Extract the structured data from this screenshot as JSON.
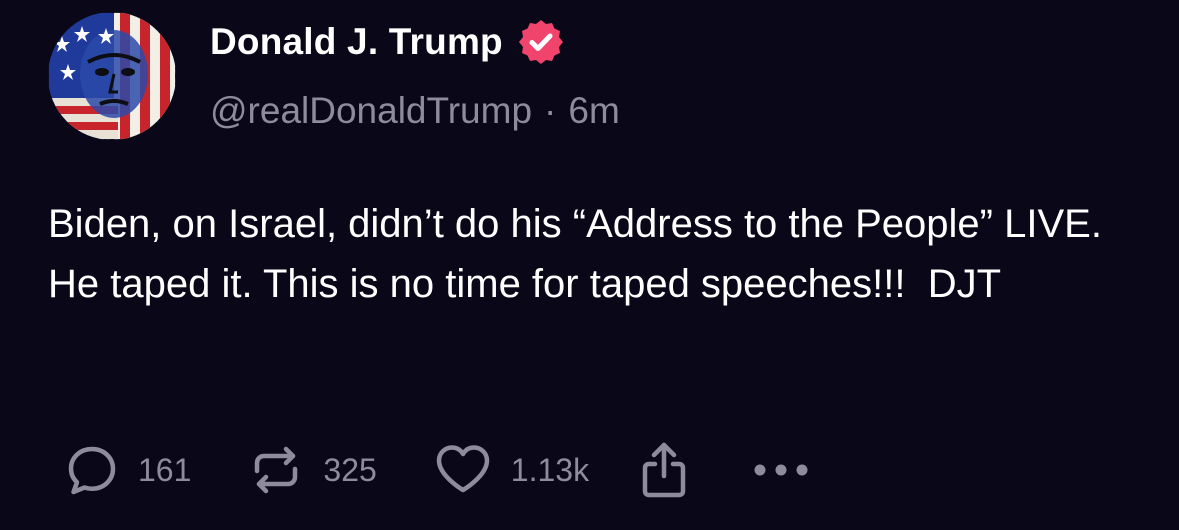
{
  "post": {
    "author": {
      "display_name": "Donald J. Trump",
      "handle": "@realDonaldTrump",
      "verified": true,
      "verified_color": "#f0446c"
    },
    "time_ago": "6m",
    "separator": "·",
    "body": "Biden, on Israel, didn’t do his “Address to the People” LIVE. He taped it. This is no time for taped speeches!!!  DJT",
    "actions": {
      "reply": {
        "icon": "reply-icon",
        "count": "161"
      },
      "repost": {
        "icon": "repost-icon",
        "count": "325"
      },
      "like": {
        "icon": "heart-icon",
        "count": "1.13k"
      },
      "share": {
        "icon": "share-icon"
      },
      "more": {
        "icon": "more-icon"
      }
    }
  },
  "colors": {
    "background": "#0a0818",
    "text": "#ffffff",
    "muted": "#8e8c9c"
  }
}
